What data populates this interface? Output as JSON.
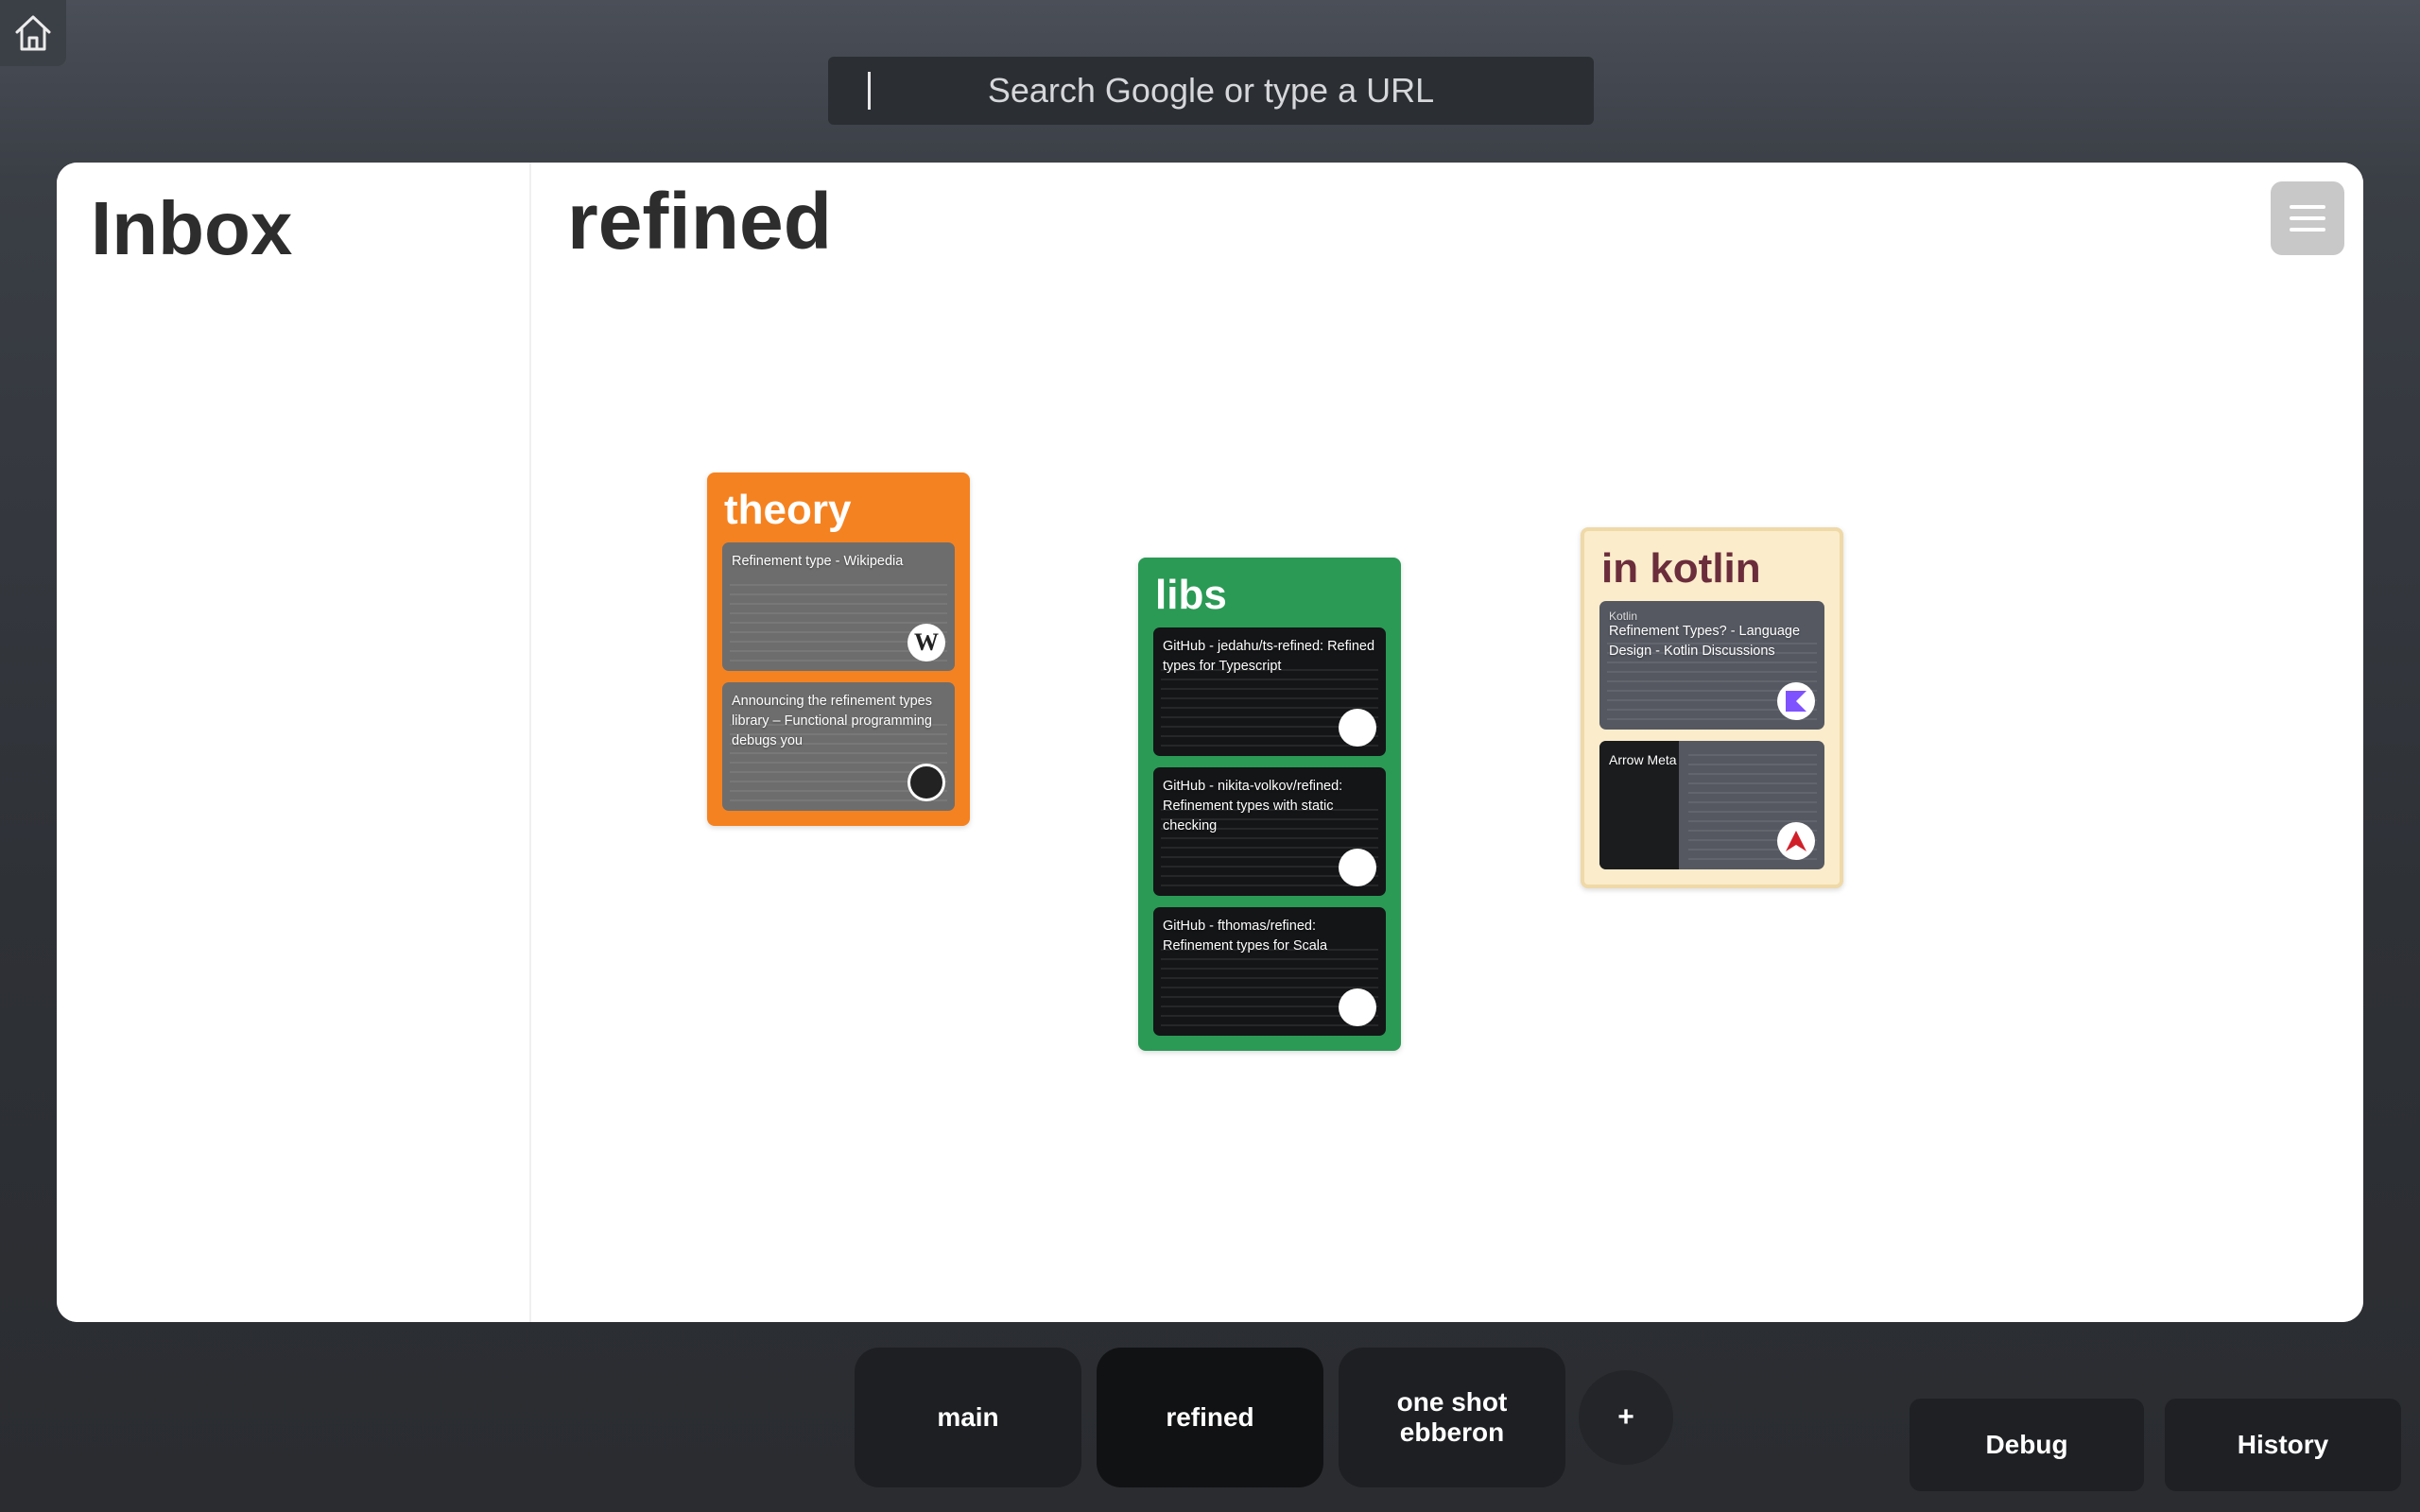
{
  "search": {
    "placeholder": "Search Google or type a URL"
  },
  "inbox": {
    "title": "Inbox"
  },
  "canvas": {
    "title": "refined"
  },
  "groups": [
    {
      "title": "theory",
      "color": "#f58220",
      "title_color": "#ffffff",
      "tabs": [
        {
          "title": "Refinement type - Wikipedia",
          "icon": "wikipedia-icon"
        },
        {
          "title": "Announcing the refinement types library – Functional programming debugs you",
          "icon": "site-avatar-icon"
        }
      ]
    },
    {
      "title": "libs",
      "color": "#2a9a55",
      "title_color": "#ffffff",
      "tabs": [
        {
          "title": "GitHub - jedahu/ts-refined: Refined types for Typescript",
          "icon": "github-icon"
        },
        {
          "title": "GitHub - nikita-volkov/refined: Refinement types with static checking",
          "icon": "github-icon"
        },
        {
          "title": "GitHub - fthomas/refined: Refinement types for Scala",
          "icon": "github-icon"
        }
      ]
    },
    {
      "title": "in kotlin",
      "color": "#fbeccb",
      "title_color": "#6b2d3b",
      "tabs": [
        {
          "title": "Refinement Types? - Language Design - Kotlin Discussions",
          "label": "Kotlin",
          "icon": "kotlin-icon"
        },
        {
          "title": "",
          "label": "Arrow Meta",
          "icon": "arrow-icon"
        }
      ]
    }
  ],
  "spaces": [
    {
      "label": "main",
      "active": false
    },
    {
      "label": "refined",
      "active": true
    },
    {
      "label": "one shot ebberon",
      "active": false
    }
  ],
  "add_space_label": "+",
  "debug_label": "Debug",
  "history_label": "History"
}
